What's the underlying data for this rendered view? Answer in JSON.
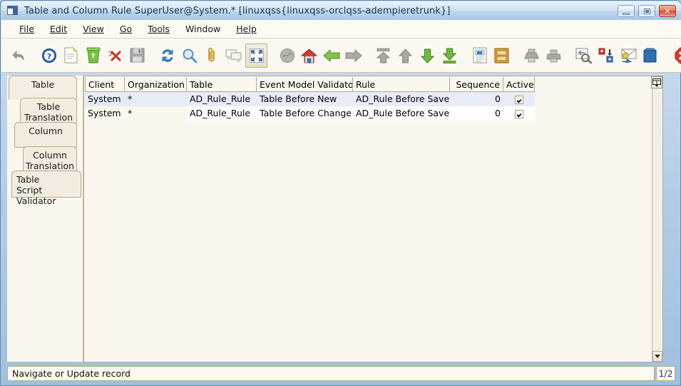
{
  "window": {
    "title": "Table and Column  Rule  SuperUser@System.* [linuxqss{linuxqss-orclqss-adempieretrunk}]",
    "icon": "window-icon",
    "buttons": {
      "minimize": "minimize-button",
      "maximize": "maximize-button",
      "close": "close-button"
    },
    "close_glyph": "✕"
  },
  "menubar": {
    "items": [
      {
        "label": "File",
        "mnemonic": "F"
      },
      {
        "label": "Edit",
        "mnemonic": "E"
      },
      {
        "label": "View",
        "mnemonic": "V"
      },
      {
        "label": "Go",
        "mnemonic": "G"
      },
      {
        "label": "Tools",
        "mnemonic": "T"
      },
      {
        "label": "Window",
        "mnemonic": "W"
      },
      {
        "label": "Help",
        "mnemonic": "H"
      }
    ]
  },
  "toolbar": {
    "items": [
      {
        "name": "undo-icon",
        "enabled": false,
        "selected": false,
        "gap": false
      },
      {
        "name": "help-icon",
        "enabled": true,
        "selected": false,
        "gap": true
      },
      {
        "name": "new-record-icon",
        "enabled": true,
        "selected": false,
        "gap": false
      },
      {
        "name": "delete-icon",
        "enabled": true,
        "selected": false,
        "gap": false
      },
      {
        "name": "delete-selection-icon",
        "enabled": true,
        "selected": false,
        "gap": false
      },
      {
        "name": "save-icon",
        "enabled": false,
        "selected": false,
        "gap": false
      },
      {
        "name": "refresh-icon",
        "enabled": true,
        "selected": false,
        "gap": true
      },
      {
        "name": "find-icon",
        "enabled": true,
        "selected": false,
        "gap": false
      },
      {
        "name": "attachment-icon",
        "enabled": true,
        "selected": false,
        "gap": false
      },
      {
        "name": "chat-icon",
        "enabled": true,
        "selected": false,
        "gap": false
      },
      {
        "name": "grid-toggle-icon",
        "enabled": true,
        "selected": true,
        "gap": false
      },
      {
        "name": "history-icon",
        "enabled": false,
        "selected": false,
        "gap": true
      },
      {
        "name": "home-icon",
        "enabled": true,
        "selected": false,
        "gap": false
      },
      {
        "name": "back-icon",
        "enabled": true,
        "selected": false,
        "gap": false
      },
      {
        "name": "forward-icon",
        "enabled": true,
        "selected": false,
        "gap": false
      },
      {
        "name": "first-record-icon",
        "enabled": true,
        "selected": false,
        "gap": true
      },
      {
        "name": "previous-record-icon",
        "enabled": true,
        "selected": false,
        "gap": false
      },
      {
        "name": "next-record-icon",
        "enabled": true,
        "selected": false,
        "gap": false
      },
      {
        "name": "last-record-icon",
        "enabled": true,
        "selected": false,
        "gap": false
      },
      {
        "name": "report-icon",
        "enabled": true,
        "selected": false,
        "gap": true
      },
      {
        "name": "archive-icon",
        "enabled": true,
        "selected": false,
        "gap": false
      },
      {
        "name": "print-preview-icon",
        "enabled": false,
        "selected": false,
        "gap": true
      },
      {
        "name": "print-icon",
        "enabled": false,
        "selected": false,
        "gap": false
      },
      {
        "name": "zoom-across-icon",
        "enabled": true,
        "selected": false,
        "gap": true
      },
      {
        "name": "active-workflow-icon",
        "enabled": true,
        "selected": false,
        "gap": false
      },
      {
        "name": "request-icon",
        "enabled": true,
        "selected": false,
        "gap": false
      },
      {
        "name": "product-info-icon",
        "enabled": true,
        "selected": false,
        "gap": false
      },
      {
        "name": "exit-icon",
        "enabled": true,
        "selected": false,
        "gap": true
      }
    ]
  },
  "tabs": {
    "items": [
      {
        "label": "Table",
        "lines": [
          "Table"
        ],
        "active": true
      },
      {
        "label": "Table Translation",
        "lines": [
          "Table",
          "Translation"
        ],
        "active": false
      },
      {
        "label": "Column",
        "lines": [
          "Column"
        ],
        "active": false
      },
      {
        "label": "Column Translation",
        "lines": [
          "Column",
          "Translation"
        ],
        "active": false
      },
      {
        "label": "Table Script Validator",
        "lines": [
          "Table",
          "Script Validator"
        ],
        "active": false
      }
    ]
  },
  "grid": {
    "columns": [
      {
        "label": "Client",
        "align": "left"
      },
      {
        "label": "Organization",
        "align": "left"
      },
      {
        "label": "Table",
        "align": "left"
      },
      {
        "label": "Event Model Validator",
        "align": "left"
      },
      {
        "label": "Rule",
        "align": "left"
      },
      {
        "label": "Sequence",
        "align": "right"
      },
      {
        "label": "Active",
        "align": "center"
      }
    ],
    "rows": [
      {
        "selected": true,
        "cells": [
          "System",
          "*",
          "AD_Rule_Rule",
          "Table Before New",
          "AD_Rule Before Save",
          "0",
          ""
        ],
        "active_checked": true
      },
      {
        "selected": false,
        "cells": [
          "System",
          "*",
          "AD_Rule_Rule",
          "Table Before Change",
          "AD_Rule Before Save",
          "0",
          ""
        ],
        "active_checked": true
      }
    ],
    "corner_button": "grid-column-menu-button",
    "scroll_up": "scroll-up-button",
    "scroll_down": "scroll-down-button"
  },
  "statusbar": {
    "message": "Navigate or Update record",
    "record_count": "1/2"
  },
  "colors": {
    "title_accent": "#16314f",
    "selected_row": "#e7ecf6",
    "panel": "#faf7ef",
    "border": "#b7ab8d",
    "close_red": "#d14e33"
  }
}
